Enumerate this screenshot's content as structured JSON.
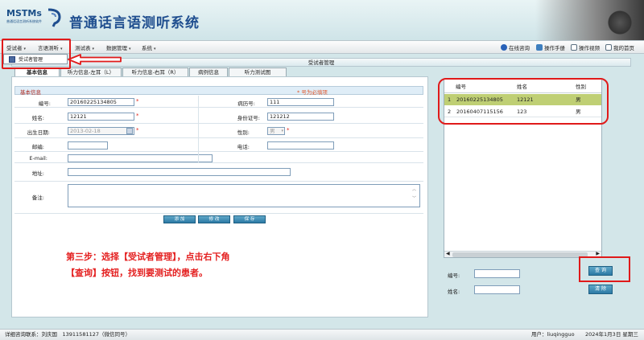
{
  "app": {
    "logo_text": "MSTMs",
    "logo_subtext": "普通话语言测听系统软件",
    "title": "普通话言语测听系统"
  },
  "menubar": {
    "menus": [
      {
        "label": "受试者",
        "arrow": "▾"
      },
      {
        "label": "言语测听",
        "arrow": "▾"
      },
      {
        "label": "测试表",
        "arrow": "▾"
      },
      {
        "label": "数据管理",
        "arrow": "▾"
      },
      {
        "label": "系统",
        "arrow": "▾"
      }
    ],
    "tools": [
      {
        "label": "在线咨询",
        "icon": "info-icon",
        "color": "#2a62b8"
      },
      {
        "label": "操作手册",
        "icon": "manual-icon",
        "color": "#3f7fbf"
      },
      {
        "label": "操作视频",
        "icon": "video-icon",
        "color": "#5a6f80"
      },
      {
        "label": "我的首页",
        "icon": "home-icon",
        "color": "#5a6f80"
      }
    ]
  },
  "dropdown": {
    "item": "受试者管理"
  },
  "form": {
    "title": "受试者管理",
    "tabs": [
      "基本信息",
      "听力信息-左耳（L）",
      "听力信息-右耳（R）",
      "病例信息",
      "听力测试图"
    ],
    "section_title": "基本信息",
    "required_note": "* 号为必填项",
    "required_mark": "*",
    "fields": {
      "id_label": "编号:",
      "id_value": "20160225134805",
      "record_label": "病历号:",
      "record_value": "111",
      "name_label": "姓名:",
      "name_value": "12121",
      "idcard_label": "身份证号:",
      "idcard_value": "121212",
      "birth_label": "出生日期:",
      "birth_value": "2013-02-18",
      "gender_label": "性别:",
      "gender_value": "男",
      "zip_label": "邮编:",
      "zip_value": "",
      "phone_label": "电话:",
      "phone_value": "",
      "email_label": "E-mail:",
      "email_value": "",
      "address_label": "地址:",
      "address_value": "",
      "note_label": "备注:",
      "note_value": ""
    },
    "buttons": [
      "添 加",
      "修 改",
      "保 存"
    ]
  },
  "instruction": {
    "line1": "第三步：选择【受试者管理】，点击右下角",
    "line2": "【查询】按钮，找到要测试的患者。"
  },
  "grid": {
    "headers": [
      "编号",
      "姓名",
      "性别"
    ],
    "rows": [
      {
        "num": "1",
        "id": "20160225134805",
        "name": "12121",
        "gender": "男"
      },
      {
        "num": "2",
        "id": "20160407115156",
        "name": "123",
        "gender": "男"
      }
    ],
    "selected_color": "#bfcf74"
  },
  "search": {
    "id_label": "编号:",
    "name_label": "姓名:",
    "query_button": "查 询",
    "clear_button": "清 除"
  },
  "statusbar": {
    "contact": "详细咨询联系：刘庆国　13911581127（微信同号）",
    "user": "用户：liuqingguo",
    "date": "2024年1月3日 星期三"
  },
  "highlight_color": "#e01a1a"
}
